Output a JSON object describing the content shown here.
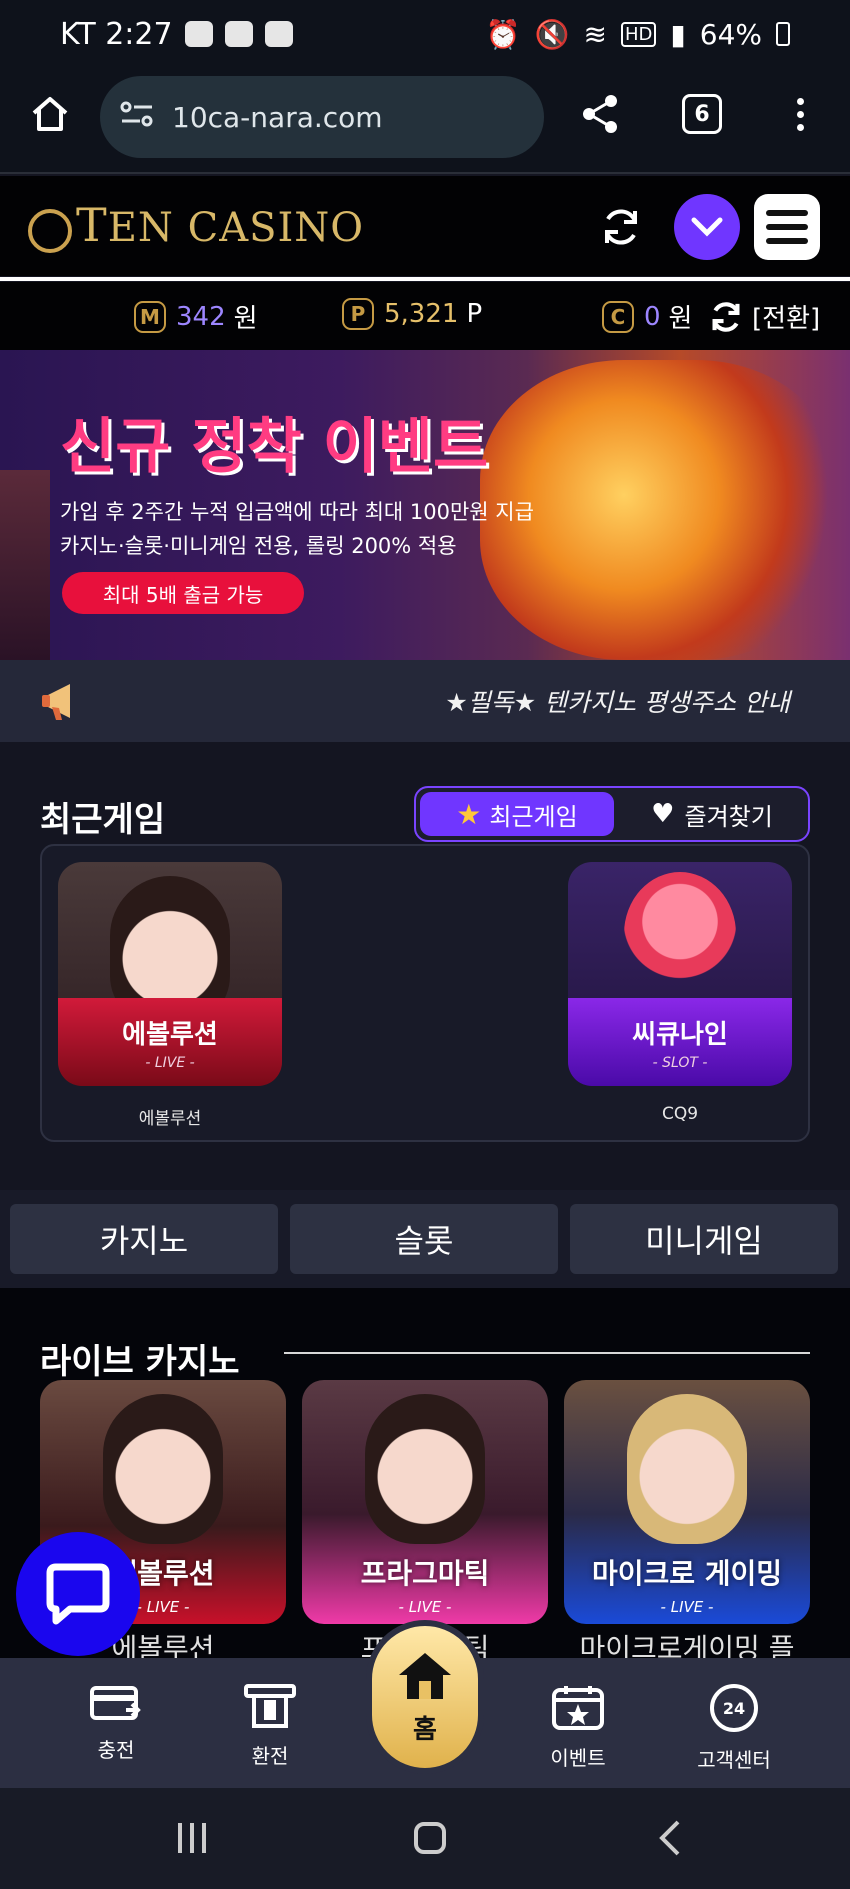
{
  "status_bar": {
    "carrier_time": "KT 2:27",
    "battery": "64%",
    "hd": "HD"
  },
  "browser": {
    "url": "10ca-nara.com",
    "tab_count": "6"
  },
  "header": {
    "logo": "TenCasino",
    "logo_first": "T",
    "logo_rest": "EN CASINO"
  },
  "wallet": {
    "m_badge": "M",
    "m_value": "342",
    "m_unit": "원",
    "p_badge": "P",
    "p_value": "5,321",
    "p_unit": "P",
    "c_badge": "C",
    "c_value": "0",
    "c_unit": "원",
    "convert_label": "[전환]"
  },
  "banner": {
    "title": "신규 정착 이벤트",
    "line1": "가입 후 2주간 누적 입금액에 따라 최대 100만원 지급",
    "line2": "카지노·슬롯·미니게임 전용, 롤링 200% 적용",
    "pill": "최대 5배 출금 가능"
  },
  "notice": {
    "text": "★필독★ 텐카지노 평생주소 안내"
  },
  "recent": {
    "title": "최근게임",
    "tab_recent": "최근게임",
    "tab_favorites": "즐겨찾기",
    "games": [
      {
        "card_name": "에볼루션",
        "card_sub": "- LIVE -",
        "name": "에볼루션"
      },
      {
        "card_name": "씨큐나인",
        "card_sub": "- SLOT -",
        "name": "CQ9"
      }
    ]
  },
  "categories": [
    "카지노",
    "슬롯",
    "미니게임"
  ],
  "live_casino": {
    "title": "라이브 카지노",
    "cards": [
      {
        "card_name": "에볼루션",
        "card_sub": "- LIVE -",
        "name": "에볼루션"
      },
      {
        "card_name": "프라그마틱",
        "card_sub": "- LIVE -",
        "name": "프라그마틱"
      },
      {
        "card_name": "마이크로 게이밍",
        "card_sub": "- LIVE -",
        "name": "마이크로게이밍 플"
      }
    ]
  },
  "tabbar": {
    "charge": "충전",
    "exchange": "환전",
    "home": "홈",
    "event": "이벤트",
    "support": "고객센터",
    "support_badge": "24"
  },
  "colors": {
    "accent": "#7036ff",
    "gold": "#c59a44",
    "banner_pink": "#ff3c82",
    "chat_blue": "#1a06ee"
  }
}
